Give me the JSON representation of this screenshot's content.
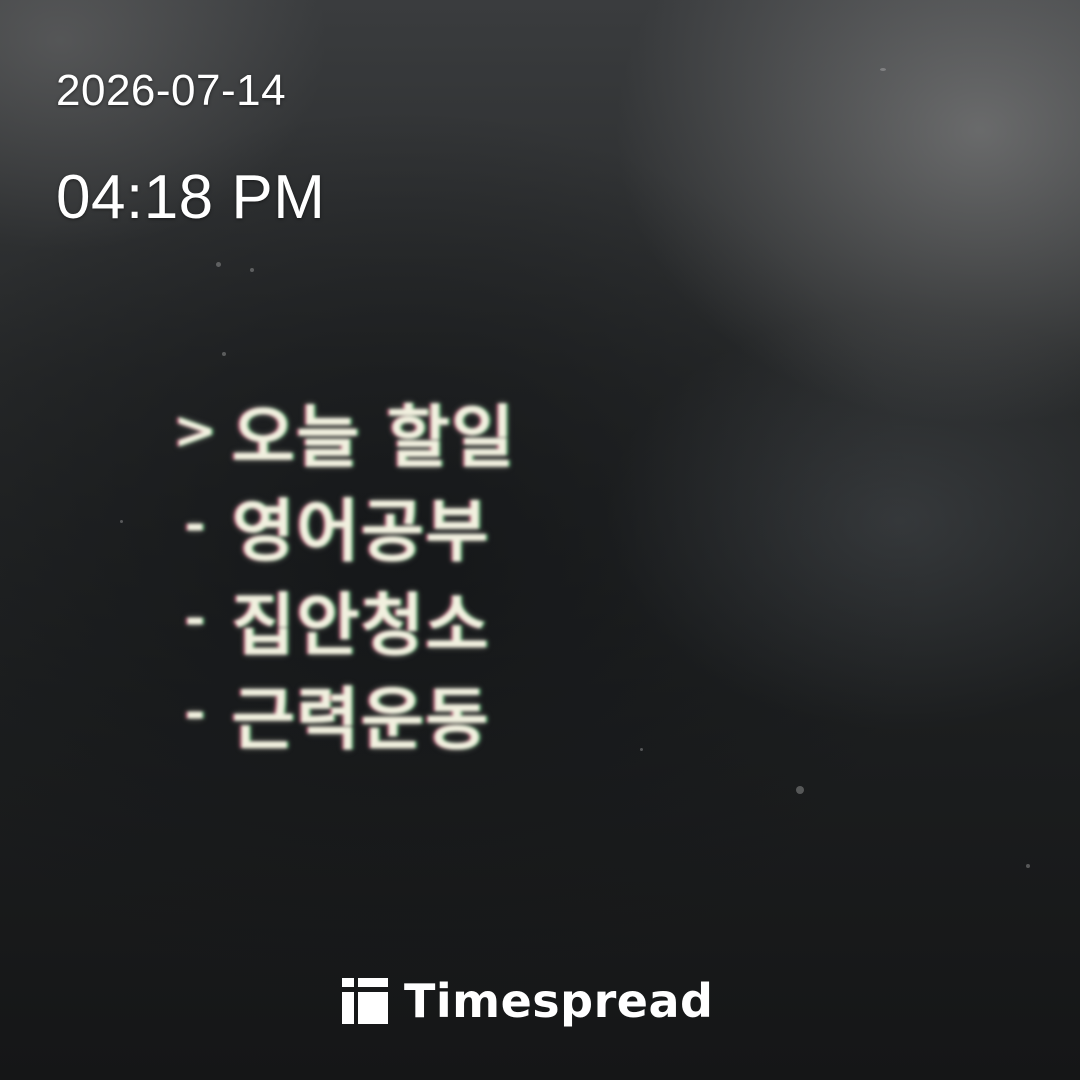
{
  "photo": {
    "subject": "photo-of-screen",
    "date": "2026-07-14",
    "time": "04:18 PM"
  },
  "screen": {
    "heading": {
      "bullet": ">",
      "text": "오늘 할일"
    },
    "items": [
      {
        "bullet": "-",
        "text": "영어공부"
      },
      {
        "bullet": "-",
        "text": "집안청소"
      },
      {
        "bullet": "-",
        "text": "근력운동"
      }
    ]
  },
  "watermark": {
    "logo_icon": "timespread-logo-icon",
    "text": "Timespread"
  },
  "colors": {
    "screen_text": "#f1f0df",
    "overlay_text": "#ffffff",
    "background": "#1b1d1e"
  }
}
